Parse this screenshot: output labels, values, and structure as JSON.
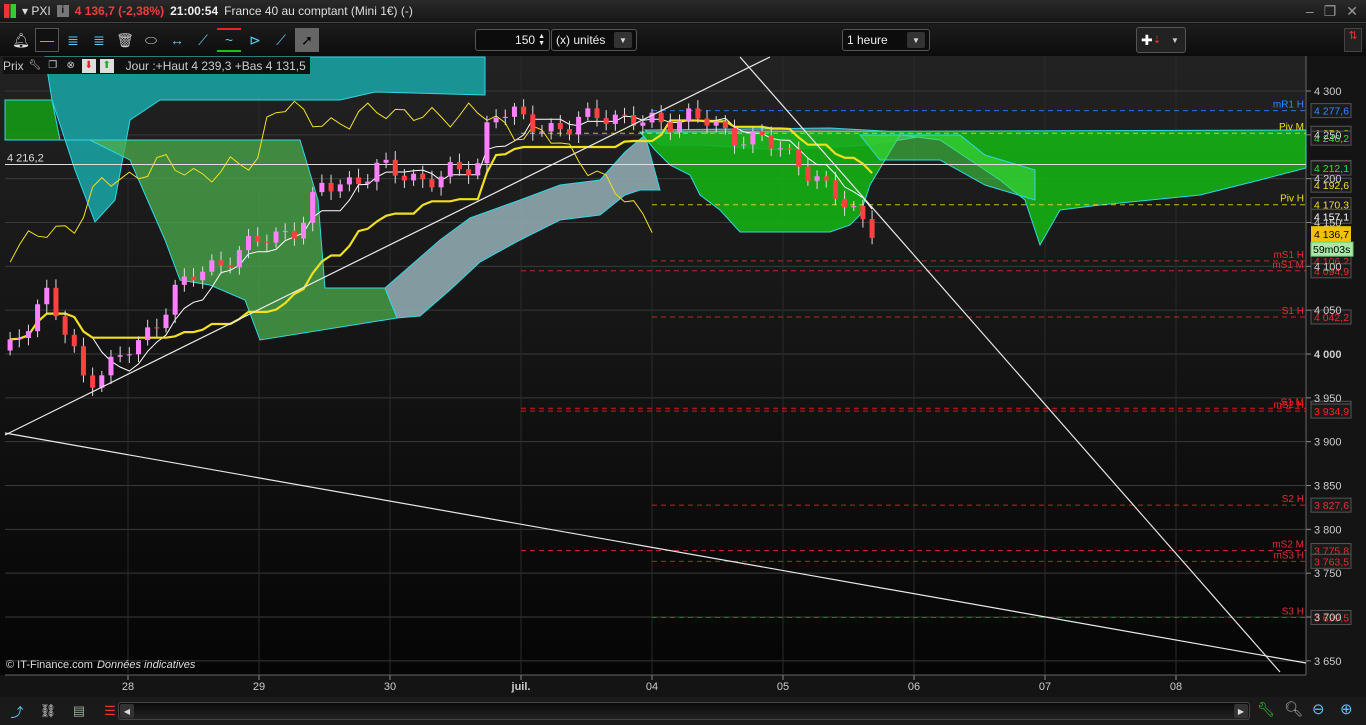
{
  "titlebar": {
    "symbol": "PXI",
    "price_change": "4 136,7 (-2,38%)",
    "time": "21:00:54",
    "instrument": "France 40 au comptant (Mini 1€) (-)"
  },
  "toolbar": {
    "units_value": "150",
    "units_label": "(x) unités",
    "timeframe": "1 heure",
    "tools": [
      "bell-icon",
      "horizontal-line-icon",
      "fibonacci-icon",
      "fibonacci-fan-icon",
      "trash-icon",
      "ellipse-icon",
      "segment-icon",
      "trendline-icon",
      "channel-icon",
      "triangle-icon",
      "ray-icon",
      "pointer-icon"
    ]
  },
  "chart_info": {
    "label": "Prix",
    "day_stats": "Jour :+Haut 4 239,3 +Bas 4 131,5"
  },
  "footer": {
    "credit": "© IT-Finance.com",
    "note": "Données indicatives"
  },
  "colors": {
    "up": "#ff80ff",
    "down": "#ff4040",
    "kijun": "#f0e020",
    "tenkan": "#ffffff",
    "cloud_green": "#1db51d",
    "cloud_teal": "#1ba6a6",
    "cloud_grey": "#8fa9b0",
    "grid": "#3a3a3a",
    "current": "#f2c200"
  },
  "chart_data": {
    "type": "candlestick",
    "ylim": [
      3640,
      4340
    ],
    "yticks": [
      {
        "v": 4300,
        "label": "4 300"
      },
      {
        "v": 4250,
        "label": "4 250"
      },
      {
        "v": 4200,
        "label": "4 200"
      },
      {
        "v": 4150,
        "label": "4 150"
      },
      {
        "v": 4100,
        "label": "4 100"
      },
      {
        "v": 4050,
        "label": "4 050"
      },
      {
        "v": 4000,
        "label": "4 000"
      },
      {
        "v": 3950,
        "label": "3 950"
      },
      {
        "v": 3900,
        "label": "3 900"
      },
      {
        "v": 3850,
        "label": "3 850"
      },
      {
        "v": 3800,
        "label": "3 800"
      },
      {
        "v": 3750,
        "label": "3 750"
      },
      {
        "v": 3700,
        "label": "3 700"
      },
      {
        "v": 3650,
        "label": "3 650"
      }
    ],
    "xticks": [
      {
        "d": 0,
        "label": "28"
      },
      {
        "d": 1,
        "label": "29"
      },
      {
        "d": 2,
        "label": "30"
      },
      {
        "d": 3,
        "label": "juil."
      },
      {
        "d": 4,
        "label": "04"
      },
      {
        "d": 5,
        "label": "05"
      },
      {
        "d": 6,
        "label": "06"
      },
      {
        "d": 7,
        "label": "07"
      },
      {
        "d": 8,
        "label": "08"
      }
    ],
    "close_path": [
      [
        -0.9,
        4004
      ],
      [
        -0.63,
        4073
      ],
      [
        -0.33,
        3970
      ],
      [
        0.09,
        4010
      ],
      [
        0.36,
        4073
      ],
      [
        0.78,
        4113
      ],
      [
        1.31,
        4147
      ],
      [
        1.47,
        4187
      ],
      [
        1.92,
        4210
      ],
      [
        2.38,
        4198
      ],
      [
        2.69,
        4221
      ],
      [
        2.76,
        4278
      ],
      [
        2.99,
        4267
      ],
      [
        3.37,
        4255
      ],
      [
        3.6,
        4278
      ],
      [
        3.91,
        4261
      ],
      [
        4.29,
        4272
      ],
      [
        4.52,
        4255
      ],
      [
        4.82,
        4244
      ],
      [
        5.13,
        4221
      ],
      [
        5.36,
        4181
      ],
      [
        5.59,
        4159
      ],
      [
        5.74,
        4137
      ]
    ],
    "reference_line": {
      "value": 4216.2,
      "label": "4 216,2"
    },
    "levels": [
      {
        "name": "mR1 H",
        "value": 4277.6,
        "label": "4 277,6",
        "color": "#2a8cff",
        "from": 4
      },
      {
        "name": "Piv M",
        "value": 4251.8,
        "label": "4 251,8",
        "color": "#f0e020",
        "from": 3
      },
      {
        "name": "",
        "value": 4246.2,
        "label": "4 246,2",
        "color": "#30e030",
        "from": null
      },
      {
        "name": "",
        "value": 4212.8,
        "label": "4 212,8",
        "color": "#9fd8ff",
        "from": null
      },
      {
        "name": "",
        "value": 4212.1,
        "label": "4 212,1",
        "color": "#30e030",
        "from": null
      },
      {
        "name": "",
        "value": 4192.6,
        "label": "4 192,6",
        "color": "#f0e020",
        "from": null
      },
      {
        "name": "Piv H",
        "value": 4170.3,
        "label": "4 170,3",
        "color": "#f0e020",
        "from": 4
      },
      {
        "name": "",
        "value": 4157.1,
        "label": "4 157,1",
        "color": "#ffffff",
        "from": null
      },
      {
        "name": "mS1 H",
        "value": 4106.2,
        "label": "4 106,2",
        "color": "#e03030",
        "from": 4
      },
      {
        "name": "mS1 M",
        "value": 4094.9,
        "label": "4 094,9",
        "color": "#e03030",
        "from": 3
      },
      {
        "name": "S1 H",
        "value": 4042.2,
        "label": "4 042,2",
        "color": "#e03030",
        "from": 4
      },
      {
        "name": "S1 M",
        "value": 3938.1,
        "label": "3 938,1",
        "color": "#ff2020",
        "from": 3
      },
      {
        "name": "mS2 H",
        "value": 3934.9,
        "label": "3 934,9",
        "color": "#ff2020",
        "from": 3
      },
      {
        "name": "S2 H",
        "value": 3827.6,
        "label": "3 827,6",
        "color": "#e03030",
        "from": 4
      },
      {
        "name": "mS2 M",
        "value": 3775.8,
        "label": "3 775,8",
        "color": "#e03030",
        "from": 3
      },
      {
        "name": "mS3 H",
        "value": 3763.5,
        "label": "3 763,5",
        "color": "#e03030",
        "from": 4
      },
      {
        "name": "S3 H",
        "value": 3699.5,
        "label": "3 699,5",
        "color": "#e03030",
        "from": 4
      }
    ],
    "current": {
      "value": 4136.7,
      "label": "4 136,7",
      "countdown": "59m03s"
    }
  }
}
